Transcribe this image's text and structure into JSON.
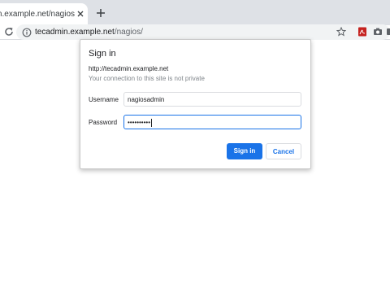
{
  "tab": {
    "title": "tecadmin.example.net/nagios/"
  },
  "address_bar": {
    "host": "tecadmin.example.net",
    "path": "/nagios/"
  },
  "icons": {
    "close": "close-icon",
    "new_tab": "plus-icon",
    "reload": "reload-icon",
    "info": "info-icon",
    "bookmark": "star-icon",
    "pdf": "pdf-extension-icon",
    "camera": "camera-extension-icon"
  },
  "dialog": {
    "title": "Sign in",
    "url": "http://tecadmin.example.net",
    "warning": "Your connection to this site is not private",
    "username_label": "Username",
    "username_value": "nagiosadmin",
    "password_label": "Password",
    "password_value": "••••••••••",
    "signin_label": "Sign in",
    "cancel_label": "Cancel"
  },
  "colors": {
    "accent": "#1a73e8",
    "tabstrip": "#dee1e6"
  }
}
